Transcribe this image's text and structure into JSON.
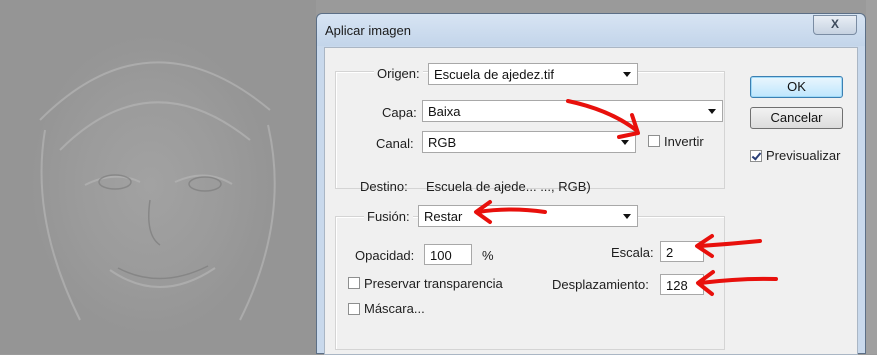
{
  "dialog": {
    "title": "Aplicar imagen",
    "close_label": "X"
  },
  "source": {
    "origen_label": "Origen:",
    "origen_value": "Escuela de ajedez.tif",
    "capa_label": "Capa:",
    "capa_value": "Baixa",
    "canal_label": "Canal:",
    "canal_value": "RGB",
    "invertir_label": "Invertir",
    "invertir_checked": false
  },
  "destination": {
    "label": "Destino:",
    "value": "Escuela de ajede... ..., RGB)"
  },
  "blending": {
    "fusion_label": "Fusión:",
    "fusion_value": "Restar",
    "opacidad_label": "Opacidad:",
    "opacidad_value": "100",
    "opacidad_unit": "%",
    "escala_label": "Escala:",
    "escala_value": "2",
    "desplazamiento_label": "Desplazamiento:",
    "desplazamiento_value": "128",
    "preservar_label": "Preservar transparencia",
    "preservar_checked": false,
    "mascara_label": "Máscara...",
    "mascara_checked": false
  },
  "buttons": {
    "ok_label": "OK",
    "cancel_label": "Cancelar",
    "preview_label": "Previsualizar",
    "preview_checked": true
  },
  "colors": {
    "annotation_arrow": "#e8100c",
    "dialog_frame": "#c9d9ec",
    "client_bg": "#f0f0f0"
  }
}
